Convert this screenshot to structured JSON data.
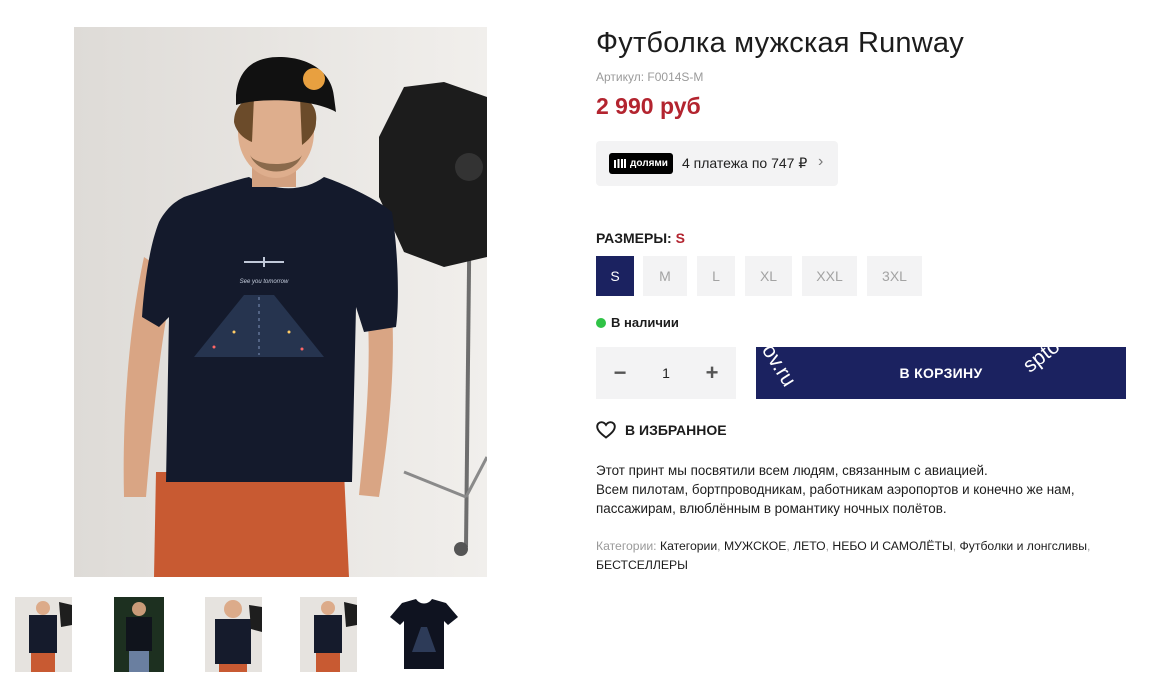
{
  "product": {
    "title": "Футболка мужская Runway",
    "sku": "Артикул: F0014S-M",
    "price": "2 990 руб"
  },
  "dolyami": {
    "logo_text": "долями",
    "text": "4 платежа по 747 ₽",
    "chevron": "›"
  },
  "sizes": {
    "label": "РАЗМЕРЫ:",
    "selected": "S",
    "options": [
      "S",
      "M",
      "L",
      "XL",
      "XXL",
      "3XL"
    ]
  },
  "stock": {
    "text": "В наличии",
    "color": "#2fc346"
  },
  "quantity": {
    "minus": "−",
    "value": "1",
    "plus": "+"
  },
  "cart": {
    "label": "В КОРЗИНУ",
    "watermark_left": "ov.ru",
    "watermark_right": "sptov"
  },
  "favorite": {
    "icon": "heart-icon",
    "label": "В ИЗБРАННОЕ"
  },
  "description": {
    "line1": "Этот принт мы посвятили всем людям, связанным с авиацией.",
    "line2": "Всем пилотам, бортпроводникам, работникам аэропортов и конечно же нам, пассажирам, влюблённым в романтику ночных полётов."
  },
  "categories": {
    "label": "Категории:",
    "items": [
      "Категории",
      "МУЖСКОЕ",
      "ЛЕТО",
      "НЕБО И САМОЛЁТЫ",
      "Футболки и лонгсливы",
      "БЕСТСЕЛЛЕРЫ"
    ]
  },
  "tshirt_print": "See you tomorrow",
  "colors": {
    "accent": "#1b2260",
    "price": "#b3242f",
    "muted_bg": "#f3f3f4"
  }
}
